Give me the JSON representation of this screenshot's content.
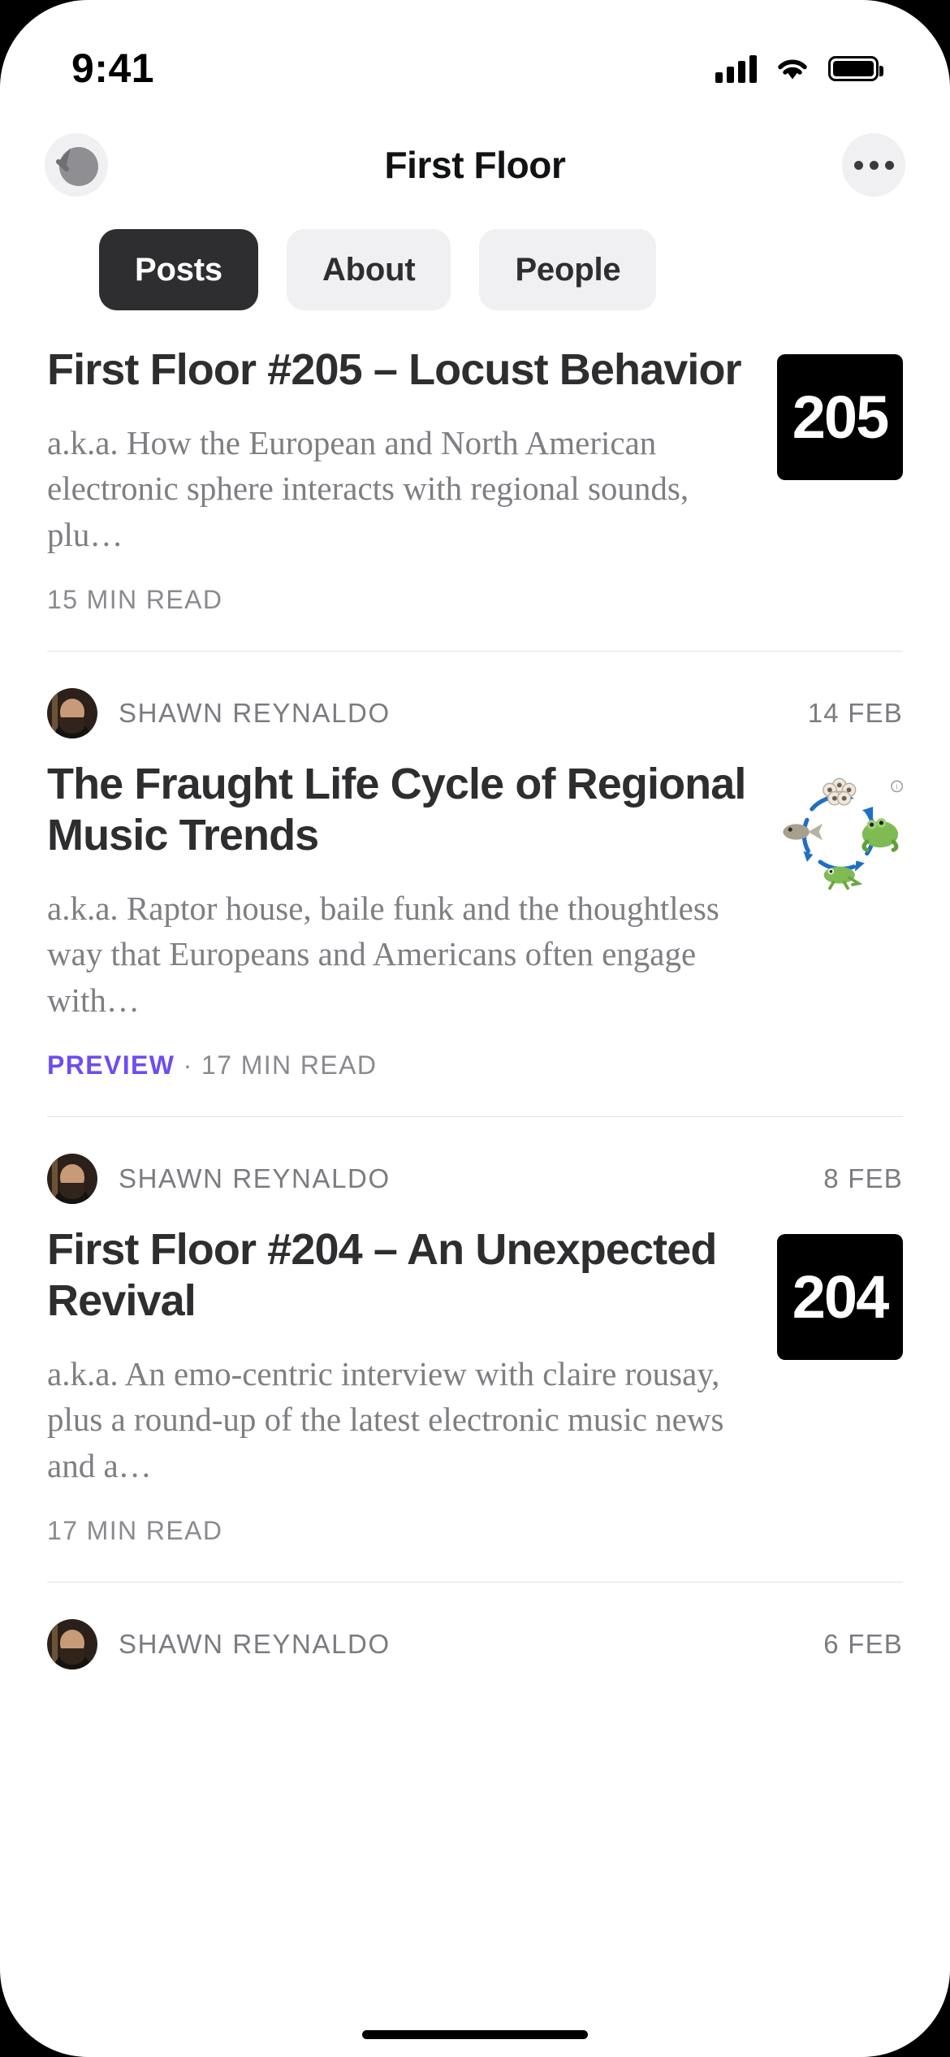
{
  "status_bar": {
    "time": "9:41",
    "signal_icon": "cellular-signal-icon",
    "wifi_icon": "wifi-icon",
    "battery_icon": "battery-full-icon"
  },
  "nav": {
    "back_icon": "back-arrow-icon",
    "title": "First Floor",
    "more_icon": "more-options-icon"
  },
  "tabs": [
    {
      "label": "Posts",
      "active": true
    },
    {
      "label": "About",
      "active": false
    },
    {
      "label": "People",
      "active": false
    }
  ],
  "posts": [
    {
      "author": "",
      "date": "",
      "title": "First Floor #205 – Locust Behavior",
      "description": "a.k.a. How the European and North American electronic sphere interacts with regional sounds, plu…",
      "preview_label": "",
      "read_time": "15 MIN READ",
      "thumb_type": "number",
      "thumb_value": "205",
      "clipped_top": true
    },
    {
      "author": "SHAWN REYNALDO",
      "date": "14 FEB",
      "title": "The Fraught Life Cycle of Regional Music Trends",
      "description": "a.k.a. Raptor house, baile funk and the thoughtless way that Europeans and Americans often engage with…",
      "preview_label": "PREVIEW",
      "meta_separator": " · ",
      "read_time": "17 MIN READ",
      "thumb_type": "frog-life-cycle-illustration",
      "thumb_value": "",
      "clipped_top": false
    },
    {
      "author": "SHAWN REYNALDO",
      "date": "8 FEB",
      "title": "First Floor #204 – An Unexpected Revival",
      "description": "a.k.a. An emo-centric interview with claire rousay, plus a round-up of the latest electronic music news and a…",
      "preview_label": "",
      "read_time": "17 MIN READ",
      "thumb_type": "number",
      "thumb_value": "204",
      "clipped_top": false
    },
    {
      "author": "SHAWN REYNALDO",
      "date": "6 FEB",
      "title": "",
      "description": "",
      "preview_label": "",
      "read_time": "",
      "thumb_type": "none",
      "thumb_value": "",
      "clipped_top": false
    }
  ],
  "colors": {
    "accent_preview": "#6c4df1",
    "tab_active_bg": "#2e2e30",
    "tab_inactive_bg": "#f0eff1",
    "title_text": "#2e2e30",
    "muted_text": "#7e7e83",
    "thumb_bg": "#000000"
  }
}
